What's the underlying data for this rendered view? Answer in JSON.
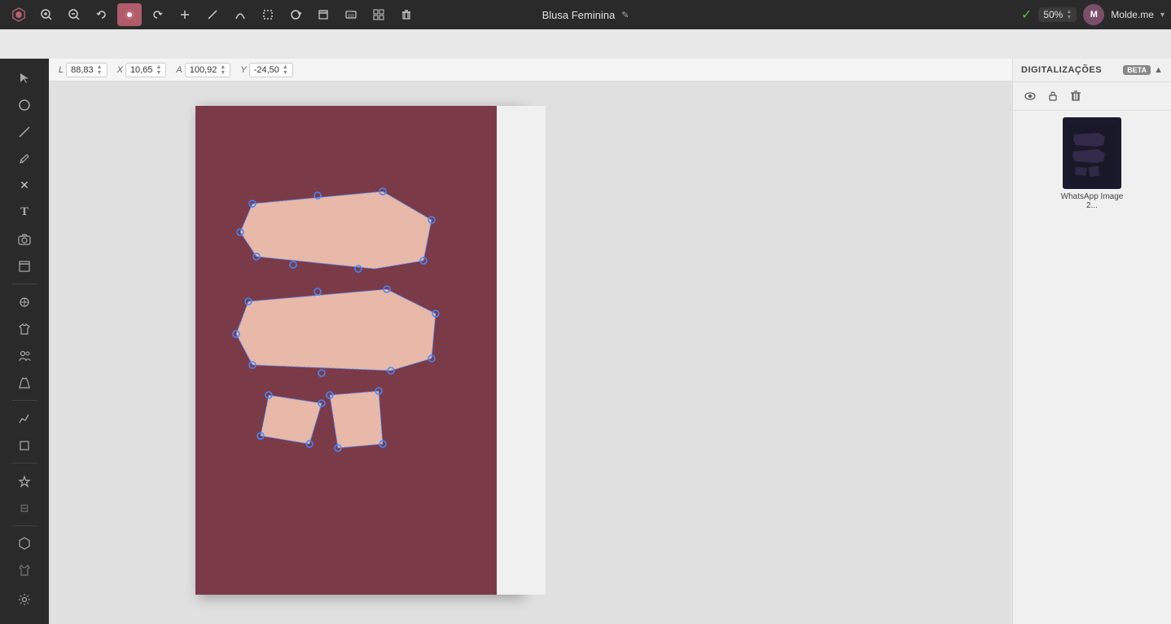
{
  "toolbar": {
    "project_name": "Blusa Feminina",
    "zoom": "50%",
    "user_initial": "M",
    "user_name": "Molde.me",
    "tools": [
      {
        "id": "logo",
        "icon": "⬡",
        "label": "logo"
      },
      {
        "id": "zoom-in",
        "icon": "🔍",
        "label": "zoom-in"
      },
      {
        "id": "zoom-out",
        "icon": "🔎",
        "label": "zoom-out"
      },
      {
        "id": "undo",
        "icon": "↩",
        "label": "undo"
      },
      {
        "id": "active-tool",
        "icon": "✏",
        "label": "active-tool"
      },
      {
        "id": "add",
        "icon": "+",
        "label": "add"
      },
      {
        "id": "line",
        "icon": "/",
        "label": "line"
      },
      {
        "id": "curve",
        "icon": "~",
        "label": "curve"
      },
      {
        "id": "rect",
        "icon": "□",
        "label": "rect"
      },
      {
        "id": "refresh",
        "icon": "↻",
        "label": "refresh"
      },
      {
        "id": "layers",
        "icon": "⊕",
        "label": "layers"
      },
      {
        "id": "print-preview",
        "icon": "🖨",
        "label": "print-preview"
      },
      {
        "id": "print",
        "icon": "⊞",
        "label": "print"
      },
      {
        "id": "delete",
        "icon": "🗑",
        "label": "delete"
      }
    ]
  },
  "coords": {
    "L": {
      "label": "L",
      "value": "88,83"
    },
    "X": {
      "label": "X",
      "value": "10,65"
    },
    "A": {
      "label": "A",
      "value": "100,92"
    },
    "Y": {
      "label": "Y",
      "value": "-24,50"
    }
  },
  "left_sidebar": {
    "tools": [
      {
        "id": "select",
        "icon": "↖",
        "label": "select"
      },
      {
        "id": "circle",
        "icon": "○",
        "label": "circle"
      },
      {
        "id": "line-tool",
        "icon": "╱",
        "label": "line-tool"
      },
      {
        "id": "pencil",
        "icon": "✎",
        "label": "pencil"
      },
      {
        "id": "close-x",
        "icon": "✕",
        "label": "close"
      },
      {
        "id": "text",
        "icon": "T",
        "label": "text"
      },
      {
        "id": "camera",
        "icon": "⊙",
        "label": "camera"
      },
      {
        "id": "layers2",
        "icon": "⧉",
        "label": "layers2"
      },
      {
        "id": "star",
        "icon": "⊛",
        "label": "star"
      },
      {
        "id": "shirt2",
        "icon": "⊞",
        "label": "shirt2"
      },
      {
        "id": "people",
        "icon": "⊕",
        "label": "people"
      },
      {
        "id": "dress2",
        "icon": "⊠",
        "label": "dress2"
      },
      {
        "id": "graph",
        "icon": "╱",
        "label": "graph"
      },
      {
        "id": "box",
        "icon": "⧠",
        "label": "box"
      },
      {
        "id": "star3",
        "icon": "✦",
        "label": "star3"
      },
      {
        "id": "clip",
        "icon": "⊞",
        "label": "clip"
      },
      {
        "id": "hexagon",
        "icon": "⬡",
        "label": "hexagon"
      },
      {
        "id": "shirt3",
        "icon": "⊟",
        "label": "shirt3"
      },
      {
        "id": "settings",
        "icon": "⚙",
        "label": "settings"
      }
    ]
  },
  "right_panel": {
    "title": "DIGITALIZAÇÕES",
    "beta_label": "BETA",
    "panel_tools": [
      {
        "id": "eye",
        "icon": "👁",
        "label": "visibility"
      },
      {
        "id": "lock",
        "icon": "🔒",
        "label": "lock"
      },
      {
        "id": "trash",
        "icon": "🗑",
        "label": "delete"
      }
    ],
    "item": {
      "label": "WhatsApp Image 2..."
    }
  }
}
